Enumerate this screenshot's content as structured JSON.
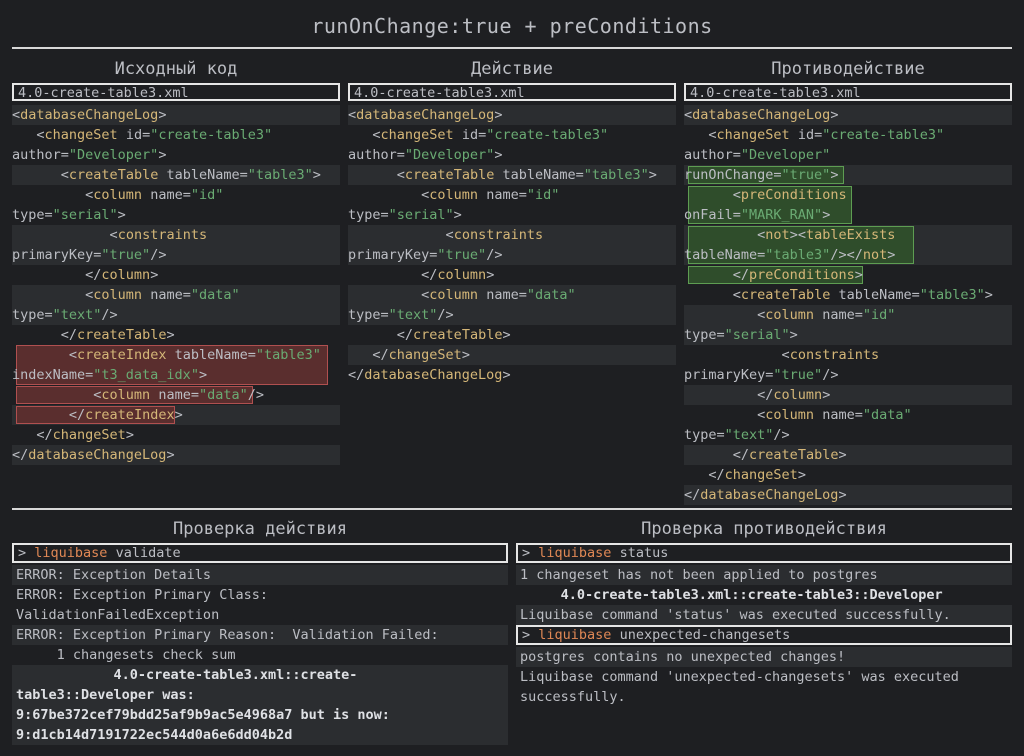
{
  "title": "runOnChange:true + preConditions",
  "columns": {
    "source": "Исходный код",
    "action": "Действие",
    "counter": "Противодействие"
  },
  "filename": "4.0-create-table3.xml",
  "bottom": {
    "action_check": "Проверка действия",
    "counter_check": "Проверка противодействия"
  },
  "terminal_left": {
    "prompt": ">",
    "program": "liquibase",
    "command": "validate",
    "lines": [
      "ERROR: Exception Details",
      "ERROR: Exception Primary Class:",
      "ValidationFailedException",
      "ERROR: Exception Primary Reason:  Validation Failed:",
      "     1 changesets check sum",
      "            4.0-create-table3.xml::create-",
      "table3::Developer was:",
      "9:67be372cef79bdd25af9b9ac5e4968a7 but is now:",
      "9:d1cb14d7191722ec544d0a6e6dd04b2d"
    ]
  },
  "terminal_right": {
    "prompt": ">",
    "program": "liquibase",
    "command1": "status",
    "lines1": [
      "1 changeset has not been applied to postgres",
      "     4.0-create-table3.xml::create-table3::Developer",
      "Liquibase command 'status' was executed successfully."
    ],
    "command2": "unexpected-changesets",
    "lines2": [
      "postgres contains no unexpected changes!",
      "Liquibase command 'unexpected-changesets' was executed",
      "successfully."
    ]
  }
}
